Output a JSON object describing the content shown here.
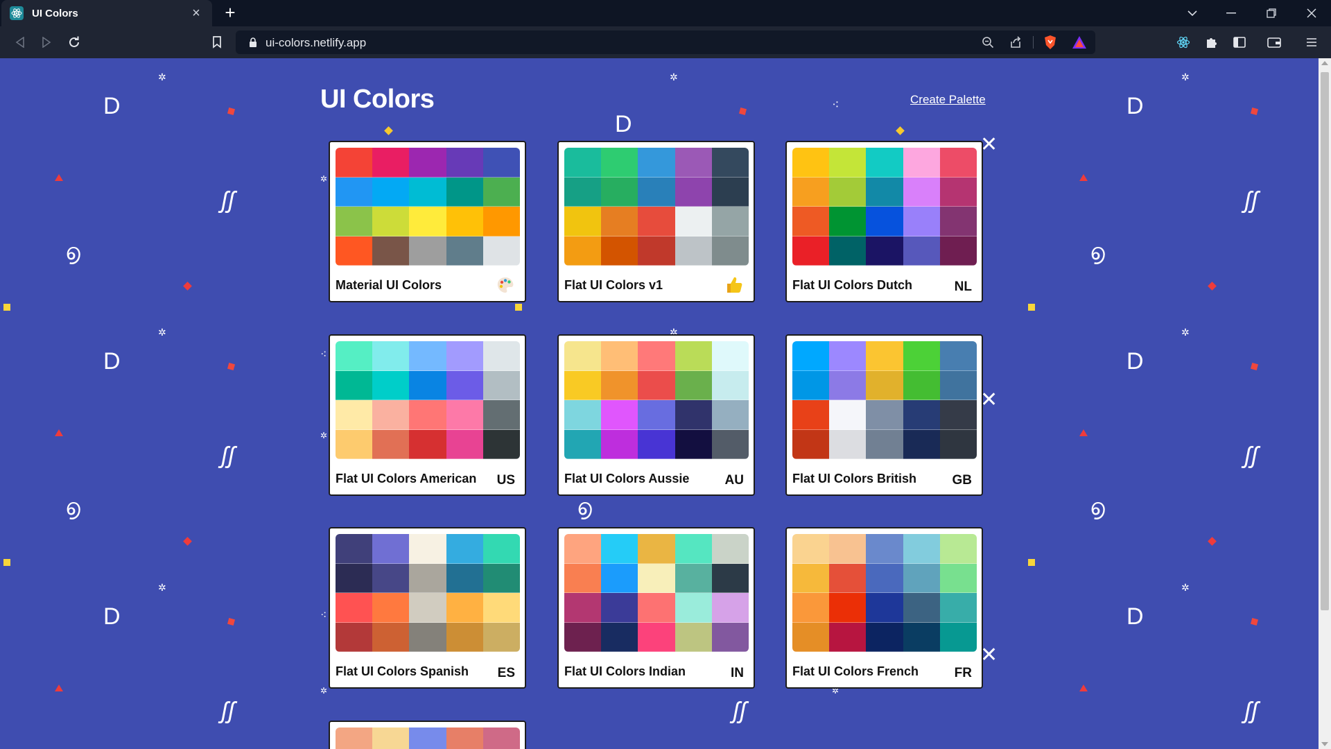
{
  "browser": {
    "tab_title": "UI Colors",
    "url": "ui-colors.netlify.app"
  },
  "header": {
    "brand": "UI Colors",
    "create_link": "Create Palette"
  },
  "palettes": [
    {
      "name": "Material UI Colors",
      "badge": "",
      "icon": "palette-icon",
      "colors": [
        "#f44336",
        "#e91e63",
        "#9c27b0",
        "#673ab7",
        "#3f51b5",
        "#2196f3",
        "#03a9f4",
        "#00bcd4",
        "#009688",
        "#4caf50",
        "#8bc34a",
        "#cddc39",
        "#ffeb3b",
        "#ffc107",
        "#ff9800",
        "#ff5722",
        "#795548",
        "#9e9e9e",
        "#607d8b",
        "#dfe3e6"
      ]
    },
    {
      "name": "Flat UI Colors v1",
      "badge": "",
      "icon": "thumbs-up-icon",
      "colors": [
        "#1abc9c",
        "#2ecc71",
        "#3498db",
        "#9b59b6",
        "#34495e",
        "#16a085",
        "#27ae60",
        "#2980b9",
        "#8e44ad",
        "#2c3e50",
        "#f1c40f",
        "#e67e22",
        "#e74c3c",
        "#ecf0f1",
        "#95a5a6",
        "#f39c12",
        "#d35400",
        "#c0392b",
        "#bdc3c7",
        "#7f8c8d"
      ]
    },
    {
      "name": "Flat UI Colors Dutch",
      "badge": "NL",
      "icon": "",
      "colors": [
        "#ffc312",
        "#c4e538",
        "#12cbc4",
        "#fda7df",
        "#ed4c67",
        "#f79f1f",
        "#a3cb38",
        "#1289a7",
        "#d980fa",
        "#b53471",
        "#ee5a24",
        "#009432",
        "#0652dd",
        "#9980fa",
        "#833471",
        "#ea2027",
        "#006266",
        "#1b1464",
        "#5758bb",
        "#6f1e51"
      ]
    },
    {
      "name": "Flat UI Colors American",
      "badge": "US",
      "icon": "",
      "colors": [
        "#55efc4",
        "#81ecec",
        "#74b9ff",
        "#a29bfe",
        "#dfe6e9",
        "#00b894",
        "#00cec9",
        "#0984e3",
        "#6c5ce7",
        "#b2bec3",
        "#ffeaa7",
        "#fab1a0",
        "#ff7675",
        "#fd79a8",
        "#636e72",
        "#fdcb6e",
        "#e17055",
        "#d63031",
        "#e84393",
        "#2d3436"
      ]
    },
    {
      "name": "Flat UI Colors Aussie",
      "badge": "AU",
      "icon": "",
      "colors": [
        "#f6e58d",
        "#ffbe76",
        "#ff7979",
        "#badc58",
        "#dff9fb",
        "#f9ca24",
        "#f0932b",
        "#eb4d4b",
        "#6ab04c",
        "#c7ecee",
        "#7ed6df",
        "#e056fd",
        "#686de0",
        "#30336b",
        "#95afc0",
        "#22a6b3",
        "#be2edd",
        "#4834d4",
        "#130f40",
        "#535c68"
      ]
    },
    {
      "name": "Flat UI Colors British",
      "badge": "GB",
      "icon": "",
      "colors": [
        "#00a8ff",
        "#9c88ff",
        "#fbc531",
        "#4cd137",
        "#487eb0",
        "#0097e6",
        "#8c7ae6",
        "#e1b12c",
        "#44bd32",
        "#40739e",
        "#e84118",
        "#f5f6fa",
        "#7f8fa6",
        "#273c75",
        "#353b48",
        "#c23616",
        "#dcdde1",
        "#718093",
        "#192a56",
        "#2f3640"
      ]
    },
    {
      "name": "Flat UI Colors Spanish",
      "badge": "ES",
      "icon": "",
      "colors": [
        "#40407a",
        "#706fd3",
        "#f7f1e3",
        "#34ace0",
        "#33d9b2",
        "#2c2c54",
        "#474787",
        "#aaa69d",
        "#227093",
        "#218c74",
        "#ff5252",
        "#ff793f",
        "#d1ccc0",
        "#ffb142",
        "#ffda79",
        "#b33939",
        "#cd6133",
        "#84817a",
        "#cc8e35",
        "#ccae62"
      ]
    },
    {
      "name": "Flat UI Colors Indian",
      "badge": "IN",
      "icon": "",
      "colors": [
        "#fea47f",
        "#25ccf7",
        "#eab543",
        "#55e6c1",
        "#cad3c8",
        "#f97f51",
        "#1b9cfc",
        "#f8efba",
        "#58b19f",
        "#2c3a47",
        "#b33771",
        "#3b3b98",
        "#fd7272",
        "#9aecdb",
        "#d6a2e8",
        "#6d214f",
        "#182c61",
        "#fc427b",
        "#bdc581",
        "#82589f"
      ]
    },
    {
      "name": "Flat UI Colors French",
      "badge": "FR",
      "icon": "",
      "colors": [
        "#fad390",
        "#f8c291",
        "#6a89cc",
        "#82ccdd",
        "#b8e994",
        "#f6b93b",
        "#e55039",
        "#4a69bd",
        "#60a3bc",
        "#78e08f",
        "#fa983a",
        "#eb2f06",
        "#1e3799",
        "#3c6382",
        "#38ada9",
        "#e58e26",
        "#b71540",
        "#0c2461",
        "#0a3d62",
        "#079992"
      ]
    }
  ],
  "partial_palette": {
    "colors": [
      "#f3a683",
      "#f7d794",
      "#778beb",
      "#e77f67",
      "#cf6a87"
    ]
  }
}
